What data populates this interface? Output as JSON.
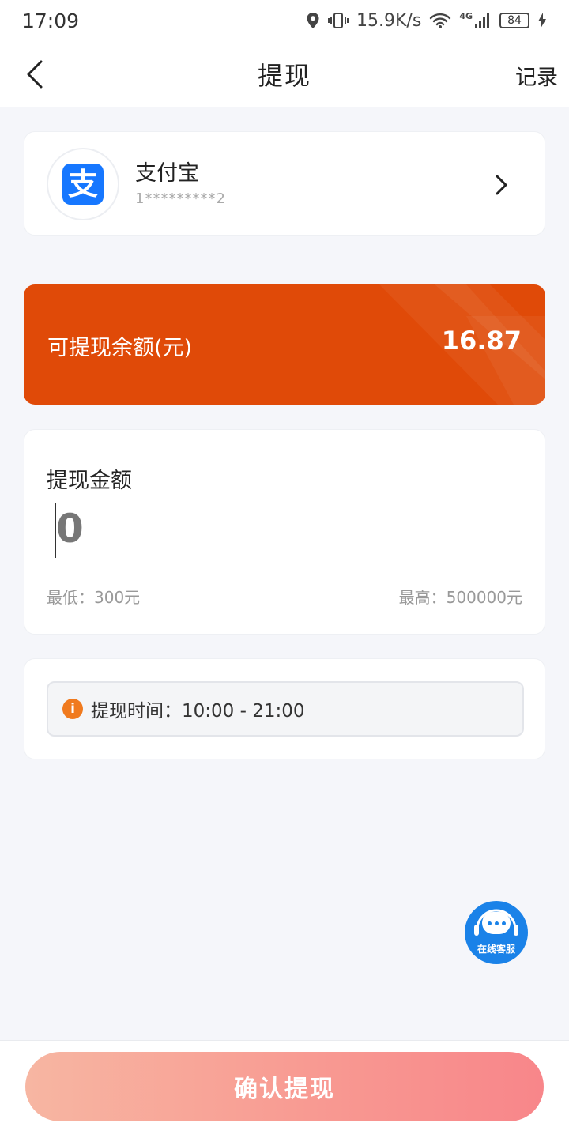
{
  "status_bar": {
    "time": "17:09",
    "network_speed": "15.9K/s",
    "network_type": "4G",
    "battery": "84",
    "icons": [
      "location-icon",
      "vibrate-icon",
      "wifi-icon",
      "signal-icon",
      "battery-icon",
      "charging-icon"
    ]
  },
  "nav": {
    "title": "提现",
    "record_label": "记录",
    "back_icon": "chevron-left-icon"
  },
  "account": {
    "name": "支付宝",
    "number": "1*********2",
    "logo_glyph": "支",
    "logo_color": "#1677ff",
    "arrow_icon": "chevron-right-icon"
  },
  "balance": {
    "label": "可提现余额(元)",
    "value": "16.87",
    "bg_color": "#e04a08"
  },
  "amount": {
    "title": "提现金额",
    "value": "0",
    "min_label": "最低：300元",
    "max_label": "最高：500000元"
  },
  "notice": {
    "icon_glyph": "i",
    "text": "提现时间：10:00 - 21:00"
  },
  "service": {
    "label": "在线客服",
    "color": "#1a82e8"
  },
  "footer": {
    "confirm_label": "确认提现"
  }
}
